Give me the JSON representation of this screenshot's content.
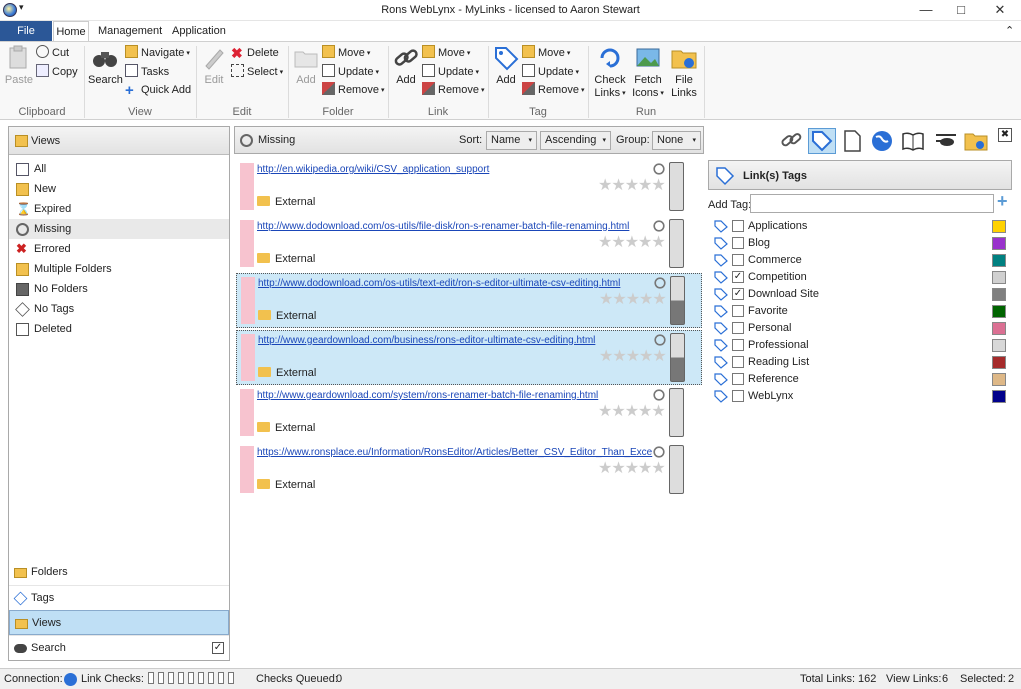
{
  "window": {
    "title": "Rons WebLynx - MyLinks - licensed to Aaron Stewart"
  },
  "tabs": [
    "File",
    "Home",
    "Management",
    "Application"
  ],
  "ribbon": {
    "clipboard": {
      "label": "Clipboard",
      "paste": "Paste",
      "cut": "Cut",
      "copy": "Copy"
    },
    "view": {
      "label": "View",
      "search": "Search",
      "navigate": "Navigate",
      "tasks": "Tasks",
      "quick_add": "Quick Add"
    },
    "edit": {
      "label": "Edit",
      "edit": "Edit",
      "delete": "Delete",
      "select": "Select"
    },
    "folder": {
      "label": "Folder",
      "add": "Add",
      "move": "Move",
      "update": "Update",
      "remove": "Remove"
    },
    "link": {
      "label": "Link",
      "add": "Add",
      "move": "Move",
      "update": "Update",
      "remove": "Remove"
    },
    "tag": {
      "label": "Tag",
      "add": "Add",
      "move": "Move",
      "update": "Update",
      "remove": "Remove"
    },
    "run": {
      "label": "Run",
      "check_links_1": "Check",
      "check_links_2": "Links",
      "fetch_icons_1": "Fetch",
      "fetch_icons_2": "Icons",
      "file_links_1": "File",
      "file_links_2": "Links"
    }
  },
  "views_panel": {
    "header": "Views",
    "items": [
      "All",
      "New",
      "Expired",
      "Missing",
      "Errored",
      "Multiple Folders",
      "No Folders",
      "No Tags",
      "Deleted"
    ],
    "selected": "Missing",
    "nav": [
      "Folders",
      "Tags",
      "Views",
      "Search"
    ],
    "nav_selected": "Views"
  },
  "center": {
    "header": "Missing",
    "sort_label": "Sort:",
    "sort_value": "Name",
    "order_value": "Ascending",
    "group_label": "Group:",
    "group_value": "None",
    "links": [
      {
        "url": "http://en.wikipedia.org/wiki/CSV_application_support",
        "folder": "External",
        "selected": false
      },
      {
        "url": "http://www.dodownload.com/os-utils/file-disk/ron-s-renamer-batch-file-renaming.html",
        "folder": "External",
        "selected": false
      },
      {
        "url": "http://www.dodownload.com/os-utils/text-edit/ron-s-editor-ultimate-csv-editing.html",
        "folder": "External",
        "selected": true
      },
      {
        "url": "http://www.geardownload.com/business/rons-editor-ultimate-csv-editing.html",
        "folder": "External",
        "selected": true
      },
      {
        "url": "http://www.geardownload.com/system/rons-renamer-batch-file-renaming.html",
        "folder": "External",
        "selected": false
      },
      {
        "url": "https://www.ronsplace.eu/Information/RonsEditor/Articles/Better_CSV_Editor_Than_Exce",
        "folder": "External",
        "selected": false
      }
    ]
  },
  "tags_panel": {
    "header": "Link(s) Tags",
    "add_tag_label": "Add Tag:",
    "add_tag_value": "",
    "tags": [
      {
        "name": "Applications",
        "checked": false,
        "color": "#ffd200"
      },
      {
        "name": "Blog",
        "checked": false,
        "color": "#9932cc"
      },
      {
        "name": "Commerce",
        "checked": false,
        "color": "#008080"
      },
      {
        "name": "Competition",
        "checked": true,
        "color": "#d0d0d0"
      },
      {
        "name": "Download Site",
        "checked": true,
        "color": "#808080"
      },
      {
        "name": "Favorite",
        "checked": false,
        "color": "#006400"
      },
      {
        "name": "Personal",
        "checked": false,
        "color": "#db7093"
      },
      {
        "name": "Professional",
        "checked": false,
        "color": "#d8d8d8"
      },
      {
        "name": "Reading List",
        "checked": false,
        "color": "#a52a2a"
      },
      {
        "name": "Reference",
        "checked": false,
        "color": "#deb887"
      },
      {
        "name": "WebLynx",
        "checked": false,
        "color": "#00008b"
      }
    ]
  },
  "status": {
    "connection_label": "Connection:",
    "link_checks_label": "Link Checks:",
    "checks_queued_label": "Checks Queued:",
    "checks_queued": "0",
    "total_links_label": "Total Links:",
    "total_links": "162",
    "view_links_label": "View Links:",
    "view_links": "6",
    "selected_label": "Selected:",
    "selected": "2"
  }
}
